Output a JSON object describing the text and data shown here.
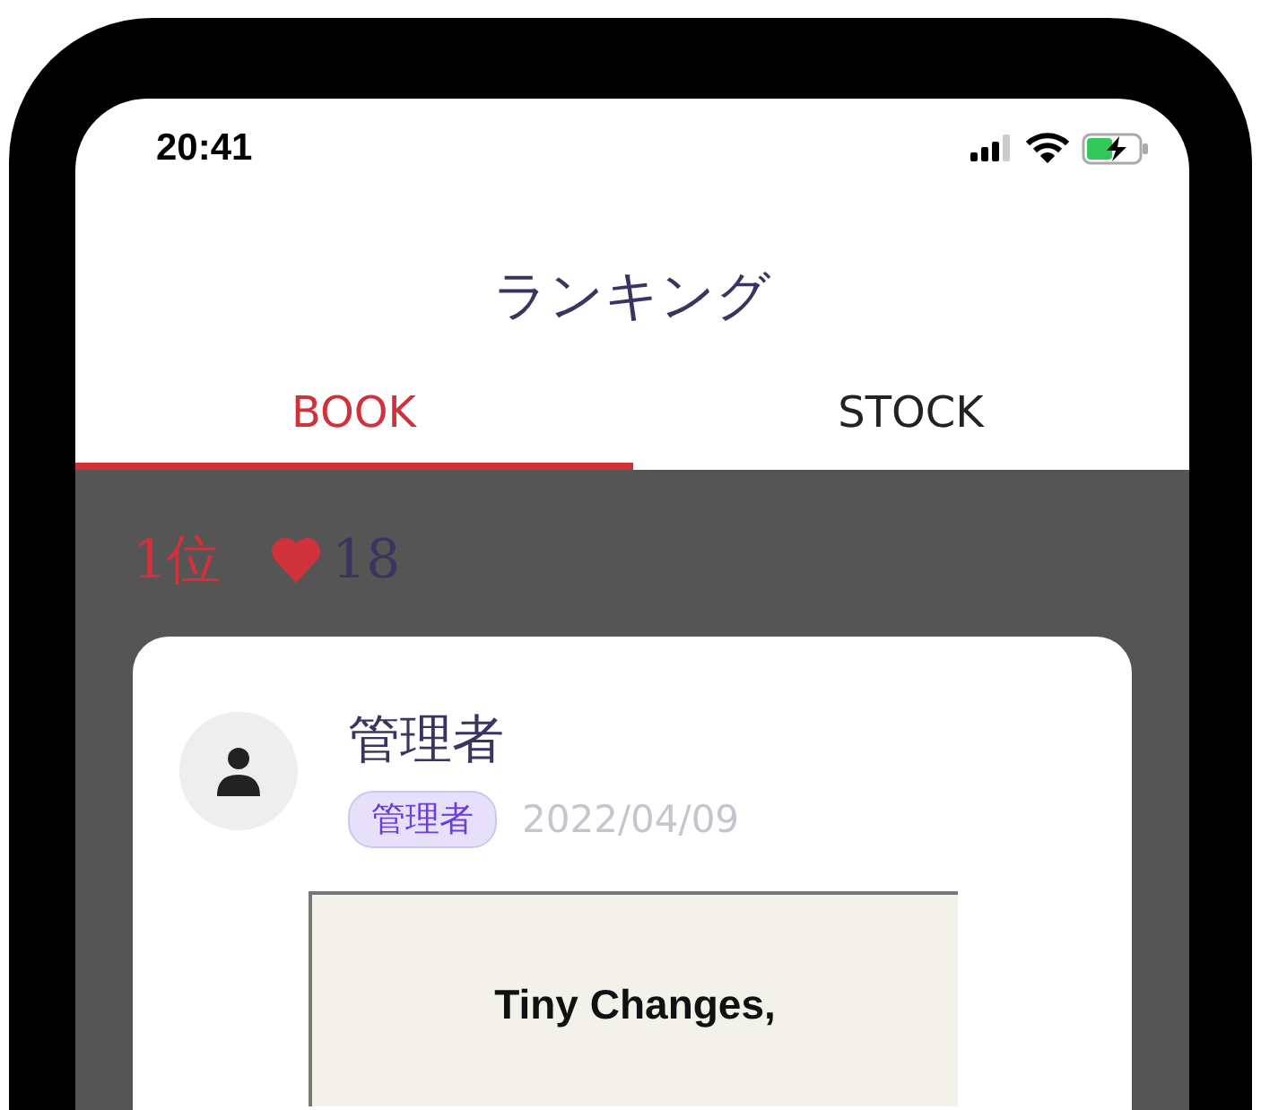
{
  "status_bar": {
    "time": "20:41"
  },
  "header": {
    "title": "ランキング"
  },
  "tabs": [
    {
      "label": "BOOK",
      "selected": true
    },
    {
      "label": "STOCK",
      "selected": false
    }
  ],
  "entry": {
    "rank": "1位",
    "likes": "18",
    "card": {
      "user_name": "管理者",
      "role_badge": "管理者",
      "date": "2022/04/09",
      "cover_text": "Tiny Changes,"
    }
  }
}
